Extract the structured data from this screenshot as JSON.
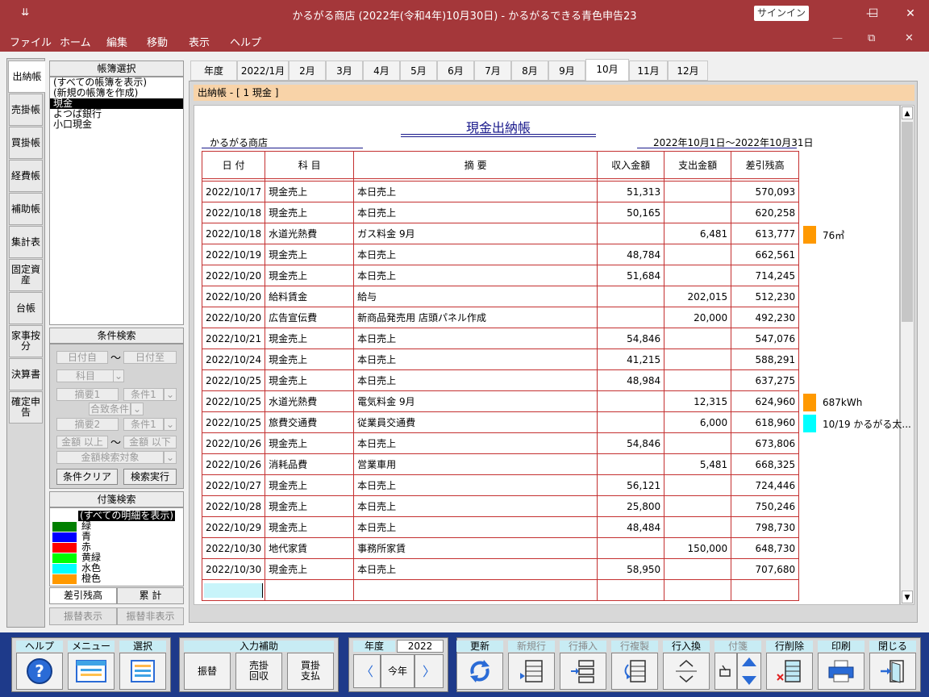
{
  "window": {
    "title": "かるがる商店 (2022年(令和4年)10月30日)  -  かるがるできる青色申告23",
    "signin": "サインイン",
    "sys_icon": "⇊",
    "minimize": "—",
    "maximize": "☐",
    "close": "✕"
  },
  "menu": [
    "ファイル",
    "ホーム",
    "編集",
    "移動",
    "表示",
    "ヘルプ"
  ],
  "menu_window": {
    "minimize": "—",
    "restore": "⧉",
    "close": "✕"
  },
  "leftnav": [
    {
      "label": "出納帳",
      "active": true
    },
    {
      "label": "売掛帳"
    },
    {
      "label": "買掛帳"
    },
    {
      "label": "経費帳"
    },
    {
      "label": "補助帳"
    },
    {
      "label": "集計表"
    },
    {
      "label": "固定資産"
    },
    {
      "label": "台帳"
    },
    {
      "label": "家事按分"
    },
    {
      "label": "決算書"
    },
    {
      "label": "確定申告"
    }
  ],
  "ledger_select": {
    "header": "帳簿選択",
    "items": [
      "(すべての帳簿を表示)",
      "(新規の帳簿を作成)",
      "現金",
      "よつば銀行",
      "小口現金"
    ],
    "selected_index": 2
  },
  "cond_search": {
    "header": "条件検索",
    "date_from": "日付自",
    "tilde1": "〜",
    "date_to": "日付至",
    "account": "科目",
    "memo1": "摘要1",
    "cond1": "条件1",
    "combine": "合致条件",
    "memo2": "摘要2",
    "cond2": "条件1",
    "amount_min": "金額 以上",
    "tilde2": "〜",
    "amount_max": "金額 以下",
    "amount_target": "金額検索対象",
    "clear_btn": "条件クリア",
    "run_btn": "検索実行"
  },
  "tag_search": {
    "header": "付箋検索",
    "all": "(すべての明細を表示)",
    "items": [
      {
        "label": "緑",
        "color": "#008000"
      },
      {
        "label": "青",
        "color": "#0000ff"
      },
      {
        "label": "赤",
        "color": "#ff0000"
      },
      {
        "label": "黄緑",
        "color": "#00ff00"
      },
      {
        "label": "水色",
        "color": "#00ffff"
      },
      {
        "label": "橙色",
        "color": "#ff9900"
      }
    ]
  },
  "mode_tabs": {
    "balance": "差引残高",
    "total": "累 計"
  },
  "transfer_tabs": {
    "show": "振替表示",
    "hide": "振替非表示"
  },
  "month_tabs": [
    "年度",
    "2022/1月",
    "2月",
    "3月",
    "4月",
    "5月",
    "6月",
    "7月",
    "8月",
    "9月",
    "10月",
    "11月",
    "12月"
  ],
  "active_month_index": 10,
  "ledger_bar": "出納帳 - [ 1 現金 ]",
  "document": {
    "title": "現金出納帳",
    "company": "かるがる商店",
    "period": "2022年10月1日〜2022年10月31日",
    "columns": [
      "日 付",
      "科 目",
      "摘   要",
      "収入金額",
      "支出金額",
      "差引残高"
    ],
    "rows": [
      {
        "date": "2022/10/17",
        "account": "現金売上",
        "memo": "本日売上",
        "income": "51,313",
        "expense": "",
        "balance": "570,093"
      },
      {
        "date": "2022/10/18",
        "account": "現金売上",
        "memo": "本日売上",
        "income": "50,165",
        "expense": "",
        "balance": "620,258"
      },
      {
        "date": "2022/10/18",
        "account": "水道光熱費",
        "memo": "ガス料金  9月",
        "income": "",
        "expense": "6,481",
        "balance": "613,777"
      },
      {
        "date": "2022/10/19",
        "account": "現金売上",
        "memo": "本日売上",
        "income": "48,784",
        "expense": "",
        "balance": "662,561"
      },
      {
        "date": "2022/10/20",
        "account": "現金売上",
        "memo": "本日売上",
        "income": "51,684",
        "expense": "",
        "balance": "714,245"
      },
      {
        "date": "2022/10/20",
        "account": "給料賃金",
        "memo": "給与",
        "income": "",
        "expense": "202,015",
        "balance": "512,230"
      },
      {
        "date": "2022/10/20",
        "account": "広告宣伝費",
        "memo": "新商品発売用  店頭パネル作成",
        "income": "",
        "expense": "20,000",
        "balance": "492,230"
      },
      {
        "date": "2022/10/21",
        "account": "現金売上",
        "memo": "本日売上",
        "income": "54,846",
        "expense": "",
        "balance": "547,076"
      },
      {
        "date": "2022/10/24",
        "account": "現金売上",
        "memo": "本日売上",
        "income": "41,215",
        "expense": "",
        "balance": "588,291"
      },
      {
        "date": "2022/10/25",
        "account": "現金売上",
        "memo": "本日売上",
        "income": "48,984",
        "expense": "",
        "balance": "637,275"
      },
      {
        "date": "2022/10/25",
        "account": "水道光熱費",
        "memo": "電気料金  9月",
        "income": "",
        "expense": "12,315",
        "balance": "624,960"
      },
      {
        "date": "2022/10/25",
        "account": "旅費交通費",
        "memo": "従業員交通費",
        "income": "",
        "expense": "6,000",
        "balance": "618,960"
      },
      {
        "date": "2022/10/26",
        "account": "現金売上",
        "memo": "本日売上",
        "income": "54,846",
        "expense": "",
        "balance": "673,806"
      },
      {
        "date": "2022/10/26",
        "account": "消耗品費",
        "memo": "営業車用",
        "income": "",
        "expense": "5,481",
        "balance": "668,325"
      },
      {
        "date": "2022/10/27",
        "account": "現金売上",
        "memo": "本日売上",
        "income": "56,121",
        "expense": "",
        "balance": "724,446"
      },
      {
        "date": "2022/10/28",
        "account": "現金売上",
        "memo": "本日売上",
        "income": "25,800",
        "expense": "",
        "balance": "750,246"
      },
      {
        "date": "2022/10/29",
        "account": "現金売上",
        "memo": "本日売上",
        "income": "48,484",
        "expense": "",
        "balance": "798,730"
      },
      {
        "date": "2022/10/30",
        "account": "地代家賃",
        "memo": "事務所家賃",
        "income": "",
        "expense": "150,000",
        "balance": "648,730"
      },
      {
        "date": "2022/10/30",
        "account": "現金売上",
        "memo": "本日売上",
        "income": "58,950",
        "expense": "",
        "balance": "707,680"
      }
    ],
    "notes": [
      {
        "row": 2,
        "color": "#ff9900",
        "text": "76㎥"
      },
      {
        "row": 10,
        "color": "#ff9900",
        "text": "687kWh"
      },
      {
        "row": 11,
        "color": "#00ffff",
        "text": "10/19  かるがる太..."
      }
    ]
  },
  "toolbar": {
    "help": "ヘルプ",
    "menu": "メニュー",
    "select": "選択",
    "input_assist": "入力補助",
    "transfer": "振替",
    "ar_collect": "売掛回収",
    "ap_pay": "買掛支払",
    "year": "年度",
    "year_value": "2022",
    "this_year": "今年",
    "prev_glyph": "〈",
    "next_glyph": "〉",
    "update": "更新",
    "new_row": "新規行",
    "insert_row": "行挿入",
    "copy_row": "行複製",
    "swap_row": "行入換",
    "tag": "付箋",
    "delete_row": "行削除",
    "print": "印刷",
    "close": "閉じる"
  }
}
